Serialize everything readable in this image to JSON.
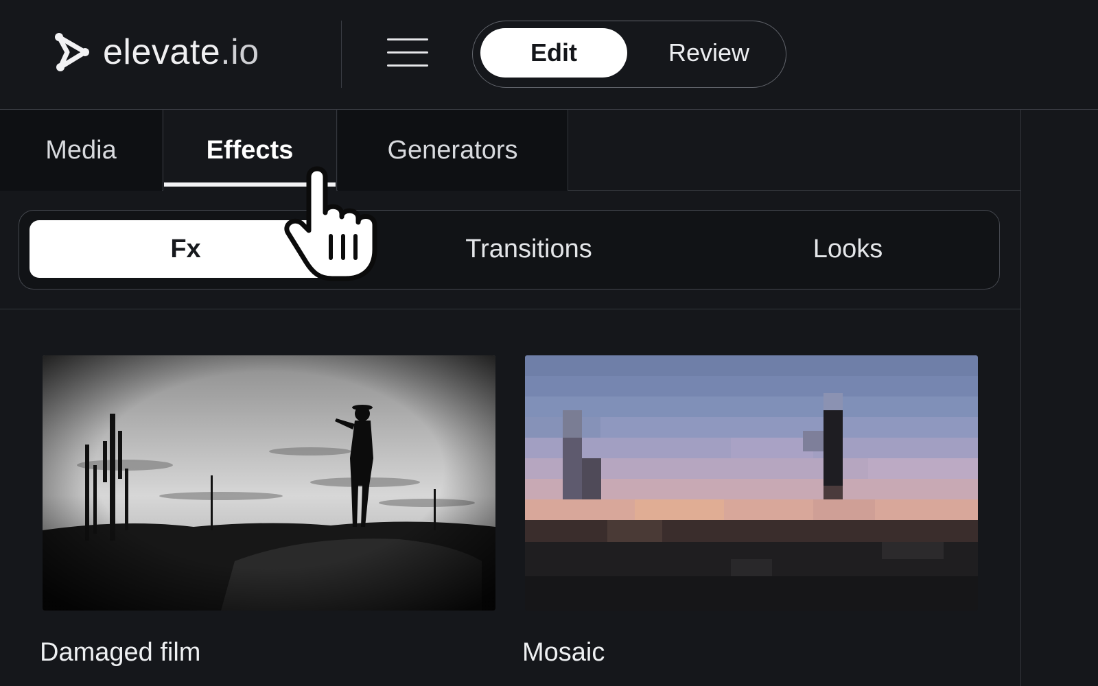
{
  "brand": {
    "name": "elevate",
    "tld": ".io",
    "logo_icon": "play-node-icon"
  },
  "header": {
    "menu_icon": "hamburger-menu-icon",
    "mode_toggle": {
      "options": [
        "Edit",
        "Review"
      ],
      "selected": "Edit"
    }
  },
  "tabs": [
    {
      "label": "Media",
      "active": false
    },
    {
      "label": "Effects",
      "active": true
    },
    {
      "label": "Generators",
      "active": false
    }
  ],
  "subtabs": [
    {
      "label": "Fx",
      "active": true
    },
    {
      "label": "Transitions",
      "active": false
    },
    {
      "label": "Looks",
      "active": false
    }
  ],
  "effects": [
    {
      "label": "Damaged film",
      "thumbnail": "grayscale desert silhouette scene"
    },
    {
      "label": "Mosaic",
      "thumbnail": "pixelated sunset scene"
    }
  ],
  "cursor": {
    "icon": "hand-pointer-icon"
  },
  "colors": {
    "background": "#15171b",
    "active_pill": "#ffffff",
    "border": "#3a3d44"
  }
}
